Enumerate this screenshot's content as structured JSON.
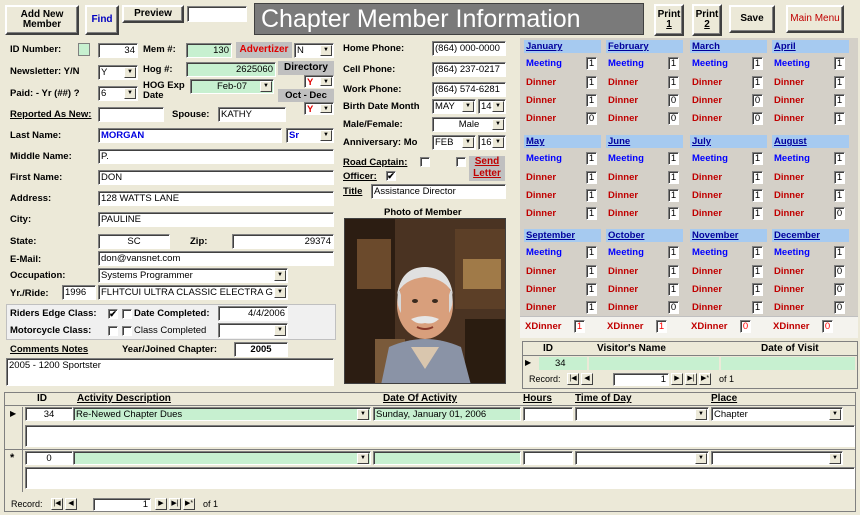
{
  "toolbar": {
    "add_new_l1": "Add New",
    "add_new_l2": "Member",
    "find": "Find",
    "preview": "Preview",
    "print1_l1": "Print",
    "print1_l2": "1",
    "print2_l1": "Print",
    "print2_l2": "2",
    "save": "Save",
    "main_menu": "Main Menu"
  },
  "title": "Chapter Member Information",
  "member": {
    "labels": {
      "id": "ID Number:",
      "mem": "Mem #:",
      "advertizer": "Advertizer",
      "newsletter": "Newsletter: Y/N",
      "hog": "Hog #:",
      "directory": "Directory",
      "paid": "Paid: - Yr (##) ?",
      "hog_exp_l1": "HOG Exp",
      "hog_exp_l2": "Date",
      "oct_dec": "Oct - Dec",
      "reported": "Reported As New:",
      "spouse": "Spouse:",
      "last": "Last Name:",
      "middle": "Middle Name:",
      "first": "First Name:",
      "address": "Address:",
      "city": "City:",
      "state": "State:",
      "zip": "Zip:",
      "email": "E-Mail:",
      "occupation": "Occupation:",
      "yr_ride": "Yr./Ride:",
      "riders_edge": "Riders Edge Class:",
      "date_completed": "Date Completed:",
      "moto_class": "Motorcycle Class:",
      "class_completed": "Class Completed",
      "comments": "Comments  Notes",
      "year_joined": "Year/Joined Chapter:",
      "home": "Home Phone:",
      "cell": "Cell Phone:",
      "work": "Work Phone:",
      "birth": "Birth Date Month",
      "male": "Male/Female:",
      "anniv": "Anniversary: Mo",
      "road": "Road Captain:",
      "send_letter_l1": "Send",
      "send_letter_l2": "Letter",
      "officer": "Officer:",
      "title_lbl": "Title",
      "photo": "Photo of Member"
    },
    "id": "34",
    "mem": "130",
    "advertizer_val": "N",
    "newsletter": "Y",
    "hog": "2625060",
    "directory_val": "Y",
    "paid": "6",
    "hog_exp": "Feb-07",
    "oct_dec_val": "Y",
    "spouse": "KATHY",
    "last": "MORGAN",
    "suffix": "Sr",
    "middle": "P.",
    "first": "DON",
    "address": "128 WATTS LANE",
    "city": "PAULINE",
    "state": "SC",
    "zip": "29374",
    "email": "don@vansnet.com",
    "occupation": "Systems Programmer",
    "year": "1996",
    "ride": "FLHTCUI ULTRA CLASSIC ELECTRA G",
    "riders_edge_check": "✔",
    "date_completed": "4/4/2006",
    "comments": "2005 - 1200 Sportster",
    "year_joined": "2005",
    "home": "(864) 000-0000",
    "cell": "(864) 237-0217",
    "work": "(864) 574-6281",
    "birth_month": "MAY",
    "birth_day": "14",
    "gender": "Male",
    "anniv_month": "FEB",
    "anniv_day": "16",
    "officer_check": "✔",
    "title_val": "Assistance Director"
  },
  "months": [
    {
      "name": "January",
      "meeting": "1",
      "d1": "1",
      "d2": "1",
      "d3": "0"
    },
    {
      "name": "February",
      "meeting": "1",
      "d1": "1",
      "d2": "0",
      "d3": "0"
    },
    {
      "name": "March",
      "meeting": "1",
      "d1": "1",
      "d2": "0",
      "d3": "0"
    },
    {
      "name": "April",
      "meeting": "1",
      "d1": "1",
      "d2": "1",
      "d3": "1"
    },
    {
      "name": "May",
      "meeting": "1",
      "d1": "1",
      "d2": "1",
      "d3": "1"
    },
    {
      "name": "June",
      "meeting": "1",
      "d1": "1",
      "d2": "1",
      "d3": "1"
    },
    {
      "name": "July",
      "meeting": "1",
      "d1": "1",
      "d2": "1",
      "d3": "1"
    },
    {
      "name": "August",
      "meeting": "1",
      "d1": "1",
      "d2": "1",
      "d3": "0"
    },
    {
      "name": "September",
      "meeting": "1",
      "d1": "1",
      "d2": "1",
      "d3": "1"
    },
    {
      "name": "October",
      "meeting": "1",
      "d1": "1",
      "d2": "1",
      "d3": "0"
    },
    {
      "name": "November",
      "meeting": "1",
      "d1": "1",
      "d2": "1",
      "d3": "1"
    },
    {
      "name": "December",
      "meeting": "1",
      "d1": "0",
      "d2": "0",
      "d3": "0"
    }
  ],
  "cal_labels": {
    "meeting": "Meeting",
    "dinner": "Dinner",
    "xdinner": "XDinner"
  },
  "xdinner": [
    "1",
    "1",
    "0",
    "0"
  ],
  "visitors": {
    "h_id": "ID",
    "h_name": "Visitor's Name",
    "h_date": "Date of Visit",
    "row_id": "34",
    "record_lbl": "Record:",
    "record_num": "1",
    "of": "of 1"
  },
  "activity": {
    "h_id": "ID",
    "h_desc": "Activity Description",
    "h_date": "Date Of Activity",
    "h_hours": "Hours",
    "h_time": "Time of Day",
    "h_place": "Place",
    "row1_id": "34",
    "row1_desc": "Re-Newed Chapter Dues",
    "row1_date": "Sunday, January 01, 2006",
    "row1_place": "Chapter",
    "row2_id": "0",
    "record_lbl": "Record:",
    "record_num": "1",
    "of": "of 1"
  }
}
